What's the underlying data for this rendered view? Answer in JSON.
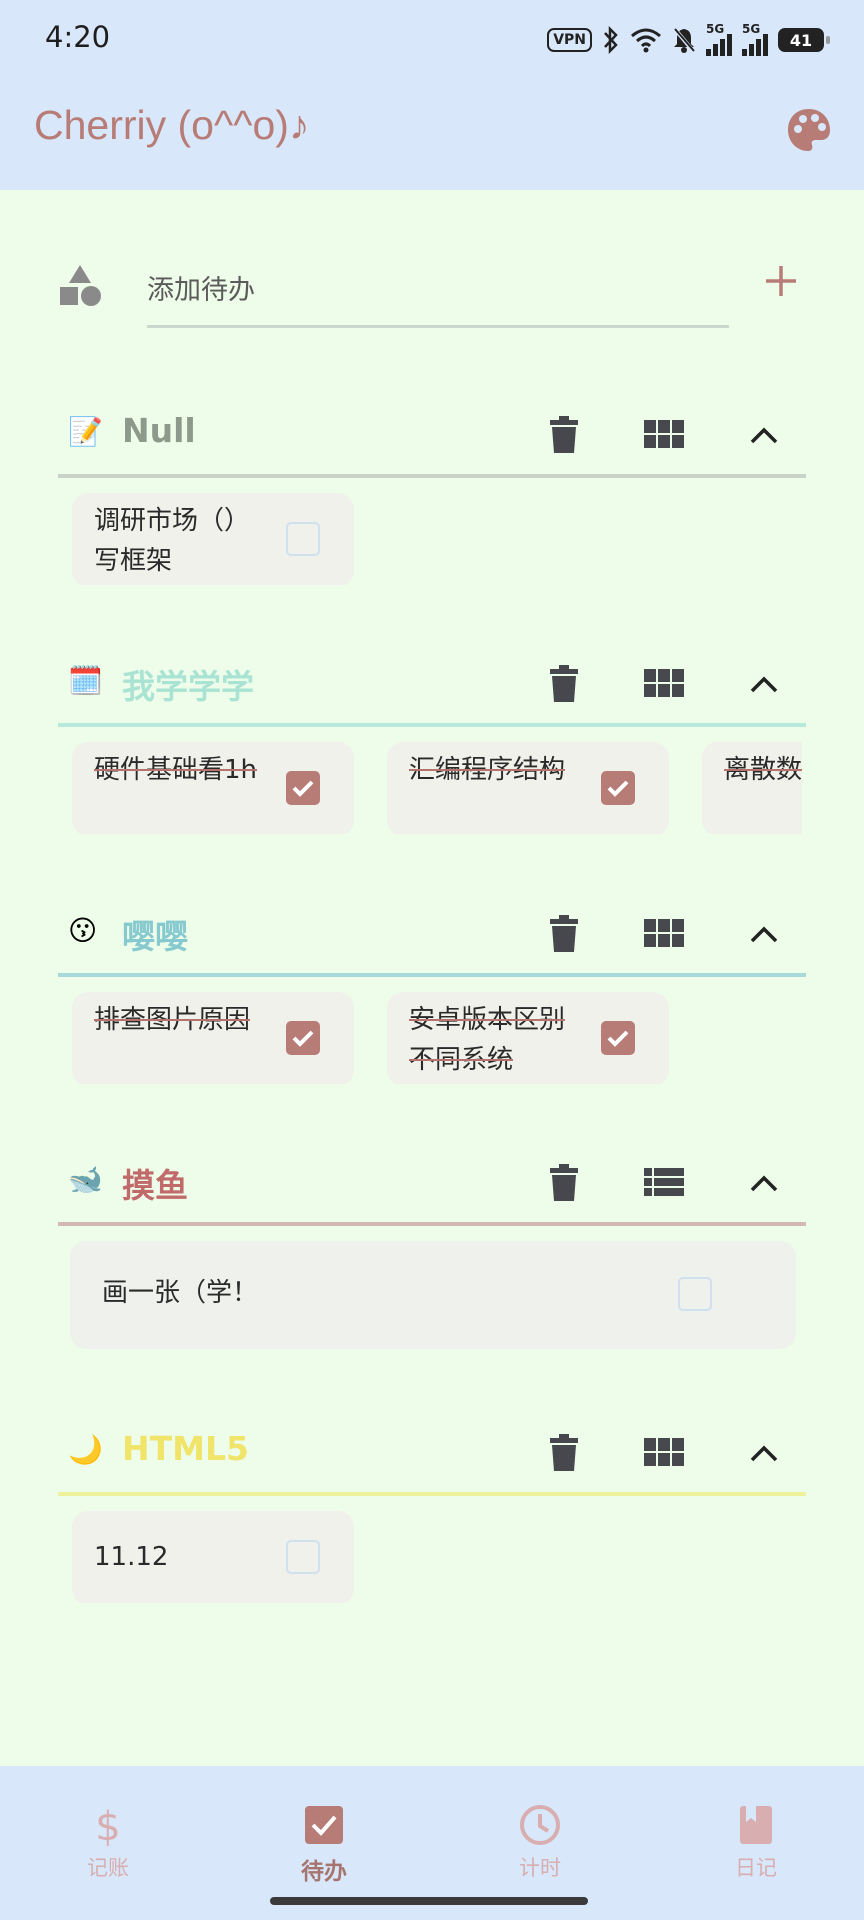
{
  "status_bar": {
    "time": "4:20",
    "vpn": "VPN",
    "net1": "5G",
    "net2": "5G",
    "battery": "41"
  },
  "app_bar": {
    "title": "Cherriy (o^^o)♪",
    "palette_icon": "palette-icon"
  },
  "add_todo": {
    "placeholder": "添加待办",
    "add_icon": "plus-icon"
  },
  "colors": {
    "accent": "#b87c77",
    "header_bg": "#d9e7fa",
    "page_bg": "#eefcea",
    "card_bg": "#f1f1ec"
  },
  "sections": [
    {
      "emoji": "📝",
      "title": "Null",
      "color": "#8d9a8b",
      "line_color": "#c9d1c9",
      "view_icon": "grid-icon",
      "items": [
        {
          "text": "调研市场（）写框架",
          "done": false
        }
      ]
    },
    {
      "emoji": "🗓️",
      "title": "我学学学",
      "color": "#a9e3d4",
      "line_color": "#b7eadb",
      "view_icon": "grid-icon",
      "items": [
        {
          "text": "硬件基础看1h",
          "done": true
        },
        {
          "text": "汇编程序结构",
          "done": true
        },
        {
          "text": "离散数业",
          "done": true
        }
      ]
    },
    {
      "emoji": "😗",
      "title": "嘤嘤",
      "color": "#86c9cf",
      "line_color": "#a9d8dc",
      "view_icon": "grid-icon",
      "items": [
        {
          "text": "排查图片原因",
          "done": true
        },
        {
          "text": "安卓版本区别 不同系统",
          "done": true
        }
      ]
    },
    {
      "emoji": "🐋",
      "title": "摸鱼",
      "color": "#c06a6a",
      "line_color": "#d2b7b3",
      "view_icon": "list-icon",
      "items": [
        {
          "text": "画一张（学！",
          "done": false
        }
      ]
    },
    {
      "emoji": "🌙",
      "title": "HTML5",
      "color": "#f0e56a",
      "line_color": "#eef29a",
      "view_icon": "grid-icon",
      "items": [
        {
          "text": "11.12",
          "done": false
        }
      ]
    }
  ],
  "bottom_nav": [
    {
      "label": "记账",
      "icon": "dollar-icon",
      "active": false
    },
    {
      "label": "待办",
      "icon": "checkbox-icon",
      "active": true
    },
    {
      "label": "计时",
      "icon": "clock-icon",
      "active": false
    },
    {
      "label": "日记",
      "icon": "book-icon",
      "active": false
    }
  ]
}
